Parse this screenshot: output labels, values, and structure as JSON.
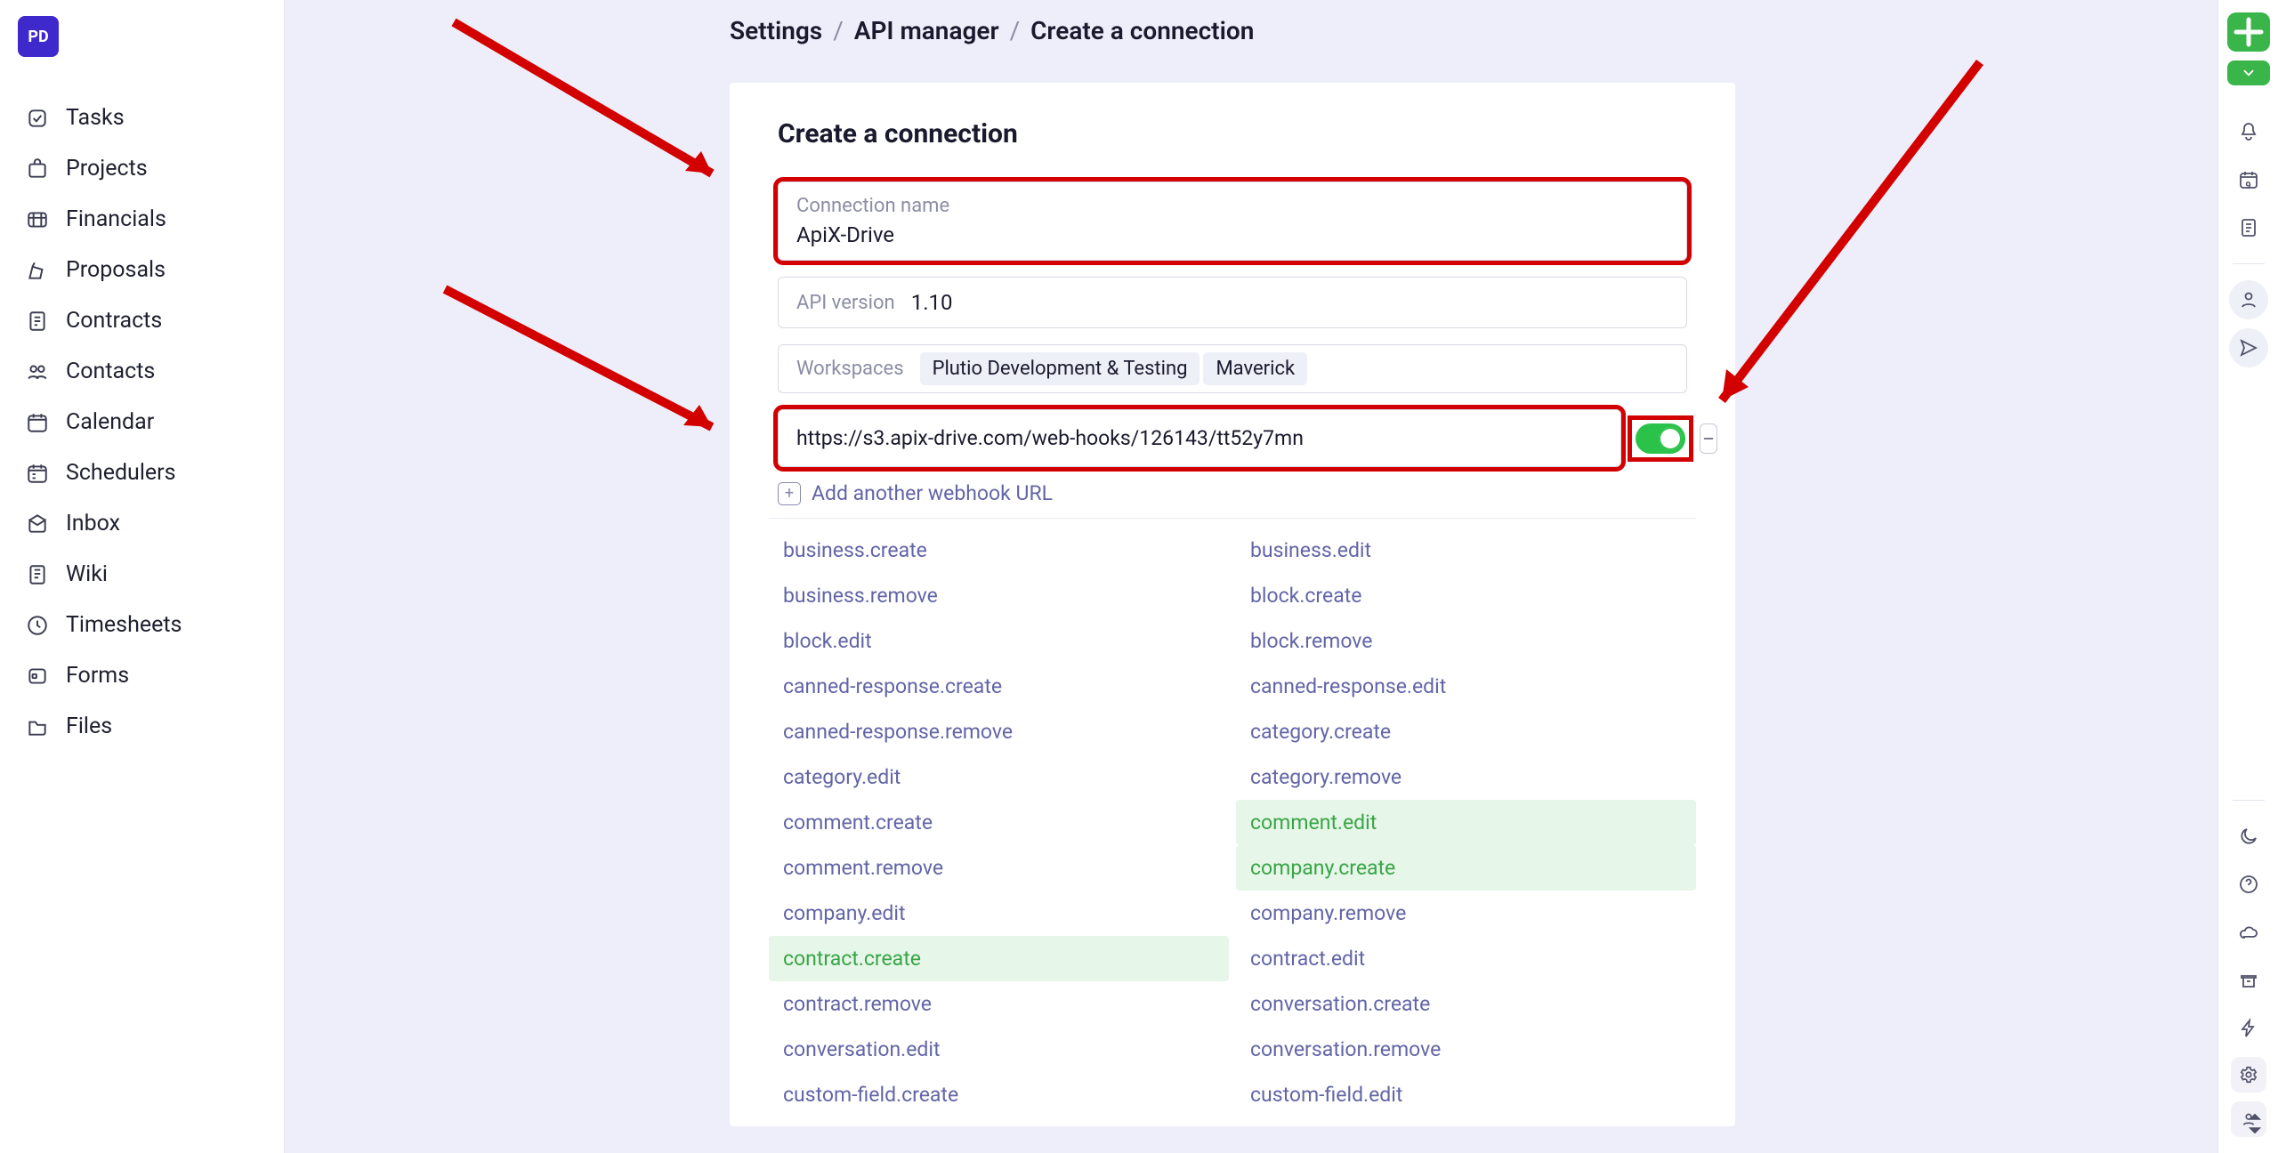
{
  "brand": {
    "initials": "PD"
  },
  "nav": {
    "items": [
      {
        "label": "Tasks"
      },
      {
        "label": "Projects"
      },
      {
        "label": "Financials"
      },
      {
        "label": "Proposals"
      },
      {
        "label": "Contracts"
      },
      {
        "label": "Contacts"
      },
      {
        "label": "Calendar"
      },
      {
        "label": "Schedulers"
      },
      {
        "label": "Inbox"
      },
      {
        "label": "Wiki"
      },
      {
        "label": "Timesheets"
      },
      {
        "label": "Forms"
      },
      {
        "label": "Files"
      }
    ]
  },
  "breadcrumb": {
    "a": "Settings",
    "b": "API manager",
    "c": "Create a connection"
  },
  "form": {
    "title": "Create a connection",
    "connection_name_label": "Connection name",
    "connection_name_value": "ApiX-Drive",
    "api_version_label": "API version",
    "api_version_value": "1.10",
    "workspaces_label": "Workspaces",
    "workspaces": [
      "Plutio Development & Testing",
      "Maverick"
    ],
    "webhook_url": "https://s3.apix-drive.com/web-hooks/126143/tt52y7mn",
    "add_webhook_label": "Add another webhook URL"
  },
  "events": {
    "left": [
      {
        "label": "business.create",
        "selected": false
      },
      {
        "label": "business.remove",
        "selected": false
      },
      {
        "label": "block.edit",
        "selected": false
      },
      {
        "label": "canned-response.create",
        "selected": false
      },
      {
        "label": "canned-response.remove",
        "selected": false
      },
      {
        "label": "category.edit",
        "selected": false
      },
      {
        "label": "comment.create",
        "selected": false
      },
      {
        "label": "comment.remove",
        "selected": false
      },
      {
        "label": "company.edit",
        "selected": false
      },
      {
        "label": "contract.create",
        "selected": true
      },
      {
        "label": "contract.remove",
        "selected": false
      },
      {
        "label": "conversation.edit",
        "selected": false
      },
      {
        "label": "custom-field.create",
        "selected": false
      }
    ],
    "right": [
      {
        "label": "business.edit",
        "selected": false
      },
      {
        "label": "block.create",
        "selected": false
      },
      {
        "label": "block.remove",
        "selected": false
      },
      {
        "label": "canned-response.edit",
        "selected": false
      },
      {
        "label": "category.create",
        "selected": false
      },
      {
        "label": "category.remove",
        "selected": false
      },
      {
        "label": "comment.edit",
        "selected": true
      },
      {
        "label": "company.create",
        "selected": true
      },
      {
        "label": "company.remove",
        "selected": false
      },
      {
        "label": "contract.edit",
        "selected": false
      },
      {
        "label": "conversation.create",
        "selected": false
      },
      {
        "label": "conversation.remove",
        "selected": false
      },
      {
        "label": "custom-field.edit",
        "selected": false
      }
    ]
  },
  "rail": {
    "calendar_day": "9"
  }
}
